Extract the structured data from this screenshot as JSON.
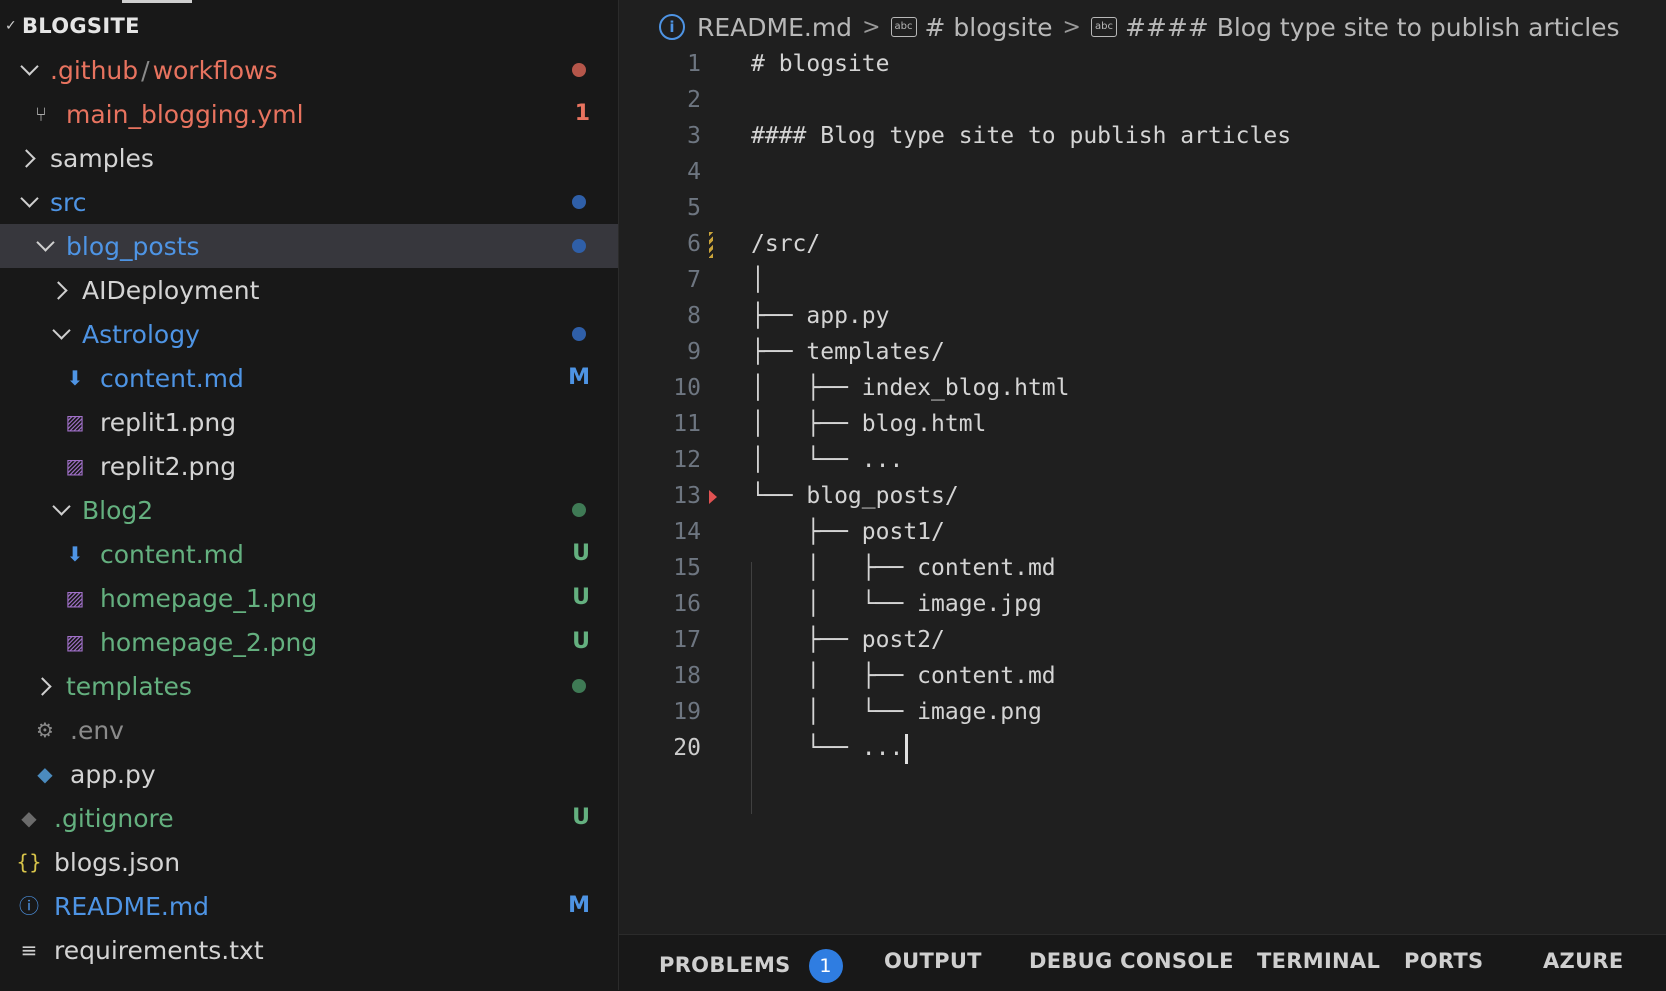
{
  "explorer": {
    "title": "BLOGSITE",
    "items": [
      {
        "name": "tree-folder-github-workflows",
        "label": ".github",
        "label_b": "workflows",
        "sep": "/",
        "indent": 20,
        "chev": "down",
        "icon": "",
        "color": "c-red",
        "badge_type": "dot",
        "badge_color": "#b5564a",
        "badge": ""
      },
      {
        "name": "tree-file-main-blogging-yml",
        "label": "main_blogging.yml",
        "indent": 28,
        "chev": "",
        "icon": "workflow-icon",
        "icon_glyph": "⑂",
        "icon_color": "#aaaaaa",
        "color": "c-red",
        "badge_type": "letter",
        "badge": "1",
        "badge_color": "#e8735f"
      },
      {
        "name": "tree-folder-samples",
        "label": "samples",
        "indent": 20,
        "chev": "right",
        "icon": "",
        "color": "c-white",
        "badge_type": "",
        "badge": ""
      },
      {
        "name": "tree-folder-src",
        "label": "src",
        "indent": 20,
        "chev": "down",
        "icon": "",
        "color": "c-blue",
        "badge_type": "dot",
        "badge_color": "#2f5fa8",
        "badge": ""
      },
      {
        "name": "tree-folder-blog-posts",
        "label": "blog_posts",
        "indent": 36,
        "chev": "down",
        "icon": "",
        "color": "c-blue",
        "badge_type": "dot",
        "badge_color": "#2f5fa8",
        "badge": "",
        "selected": true
      },
      {
        "name": "tree-folder-aideployment",
        "label": "AIDeployment",
        "indent": 52,
        "chev": "right",
        "icon": "",
        "color": "c-white",
        "badge_type": "",
        "badge": ""
      },
      {
        "name": "tree-folder-astrology",
        "label": "Astrology",
        "indent": 52,
        "chev": "down",
        "icon": "",
        "color": "c-blue",
        "badge_type": "dot",
        "badge_color": "#2f5fa8",
        "badge": ""
      },
      {
        "name": "tree-file-astrology-content-md",
        "label": "content.md",
        "indent": 62,
        "chev": "",
        "icon": "markdown-icon",
        "icon_glyph": "⬇",
        "icon_color": "#4e94e4",
        "color": "c-blue",
        "badge_type": "letter",
        "badge": "M",
        "badge_color": "#4e94e4"
      },
      {
        "name": "tree-file-replit1-png",
        "label": "replit1.png",
        "indent": 62,
        "chev": "",
        "icon": "image-icon",
        "icon_glyph": "▨",
        "icon_color": "#a070c8",
        "color": "c-white",
        "badge_type": "",
        "badge": ""
      },
      {
        "name": "tree-file-replit2-png",
        "label": "replit2.png",
        "indent": 62,
        "chev": "",
        "icon": "image-icon",
        "icon_glyph": "▨",
        "icon_color": "#a070c8",
        "color": "c-white",
        "badge_type": "",
        "badge": ""
      },
      {
        "name": "tree-folder-blog2",
        "label": "Blog2",
        "indent": 52,
        "chev": "down",
        "icon": "",
        "color": "c-green",
        "badge_type": "dot",
        "badge_color": "#3f7a55",
        "badge": ""
      },
      {
        "name": "tree-file-blog2-content-md",
        "label": "content.md",
        "indent": 62,
        "chev": "",
        "icon": "markdown-icon",
        "icon_glyph": "⬇",
        "icon_color": "#4e94e4",
        "color": "c-green",
        "badge_type": "letter",
        "badge": "U",
        "badge_color": "#64b07f"
      },
      {
        "name": "tree-file-homepage-1-png",
        "label": "homepage_1.png",
        "indent": 62,
        "chev": "",
        "icon": "image-icon",
        "icon_glyph": "▨",
        "icon_color": "#a070c8",
        "color": "c-green",
        "badge_type": "letter",
        "badge": "U",
        "badge_color": "#64b07f"
      },
      {
        "name": "tree-file-homepage-2-png",
        "label": "homepage_2.png",
        "indent": 62,
        "chev": "",
        "icon": "image-icon",
        "icon_glyph": "▨",
        "icon_color": "#a070c8",
        "color": "c-green",
        "badge_type": "letter",
        "badge": "U",
        "badge_color": "#64b07f"
      },
      {
        "name": "tree-folder-templates",
        "label": "templates",
        "indent": 36,
        "chev": "right",
        "icon": "",
        "color": "c-green",
        "badge_type": "dot",
        "badge_color": "#3f7a55",
        "badge": ""
      },
      {
        "name": "tree-file-env",
        "label": ".env",
        "indent": 32,
        "chev": "",
        "icon": "gear-icon",
        "icon_glyph": "⚙",
        "icon_color": "#8a8a8a",
        "color": "c-gray",
        "badge_type": "",
        "badge": ""
      },
      {
        "name": "tree-file-app-py",
        "label": "app.py",
        "indent": 32,
        "chev": "",
        "icon": "python-icon",
        "icon_glyph": "◆",
        "icon_color": "#4b8bbe",
        "color": "c-white",
        "badge_type": "",
        "badge": ""
      },
      {
        "name": "tree-file-gitignore",
        "label": ".gitignore",
        "indent": 16,
        "chev": "",
        "icon": "git-icon",
        "icon_glyph": "◆",
        "icon_color": "#6b6b6b",
        "color": "c-green",
        "badge_type": "letter",
        "badge": "U",
        "badge_color": "#64b07f"
      },
      {
        "name": "tree-file-blogs-json",
        "label": "blogs.json",
        "indent": 16,
        "chev": "",
        "icon": "json-icon",
        "icon_glyph": "{}",
        "icon_color": "#d7c44a",
        "color": "c-white",
        "badge_type": "",
        "badge": ""
      },
      {
        "name": "tree-file-readme-md",
        "label": "README.md",
        "indent": 16,
        "chev": "",
        "icon": "info-icon",
        "icon_glyph": "ⓘ",
        "icon_color": "#4e94e4",
        "color": "c-blue",
        "badge_type": "letter",
        "badge": "M",
        "badge_color": "#4e94e4"
      },
      {
        "name": "tree-file-requirements-txt",
        "label": "requirements.txt",
        "indent": 16,
        "chev": "",
        "icon": "text-file-icon",
        "icon_glyph": "≡",
        "icon_color": "#cfcfcf",
        "color": "c-white",
        "badge_type": "",
        "badge": ""
      }
    ]
  },
  "breadcrumb": {
    "file": "README.md",
    "h1": "# blogsite",
    "h4": "#### Blog type site to publish articles",
    "sep": ">"
  },
  "editor": {
    "lines": [
      "# blogsite",
      "",
      "#### Blog type site to publish articles",
      "",
      "",
      "/src/",
      "│",
      "├── app.py",
      "├── templates/",
      "│   ├── index_blog.html",
      "│   ├── blog.html",
      "│   └── ...",
      "└── blog_posts/",
      "    ├── post1/",
      "    │   ├── content.md",
      "    │   └── image.jpg",
      "    ├── post2/",
      "    │   ├── content.md",
      "    │   └── image.png",
      "    └── ..."
    ],
    "active_line": 20
  },
  "panel": {
    "tabs": [
      "PROBLEMS",
      "OUTPUT",
      "DEBUG CONSOLE",
      "TERMINAL",
      "PORTS",
      "AZURE"
    ],
    "problems_count": "1"
  }
}
